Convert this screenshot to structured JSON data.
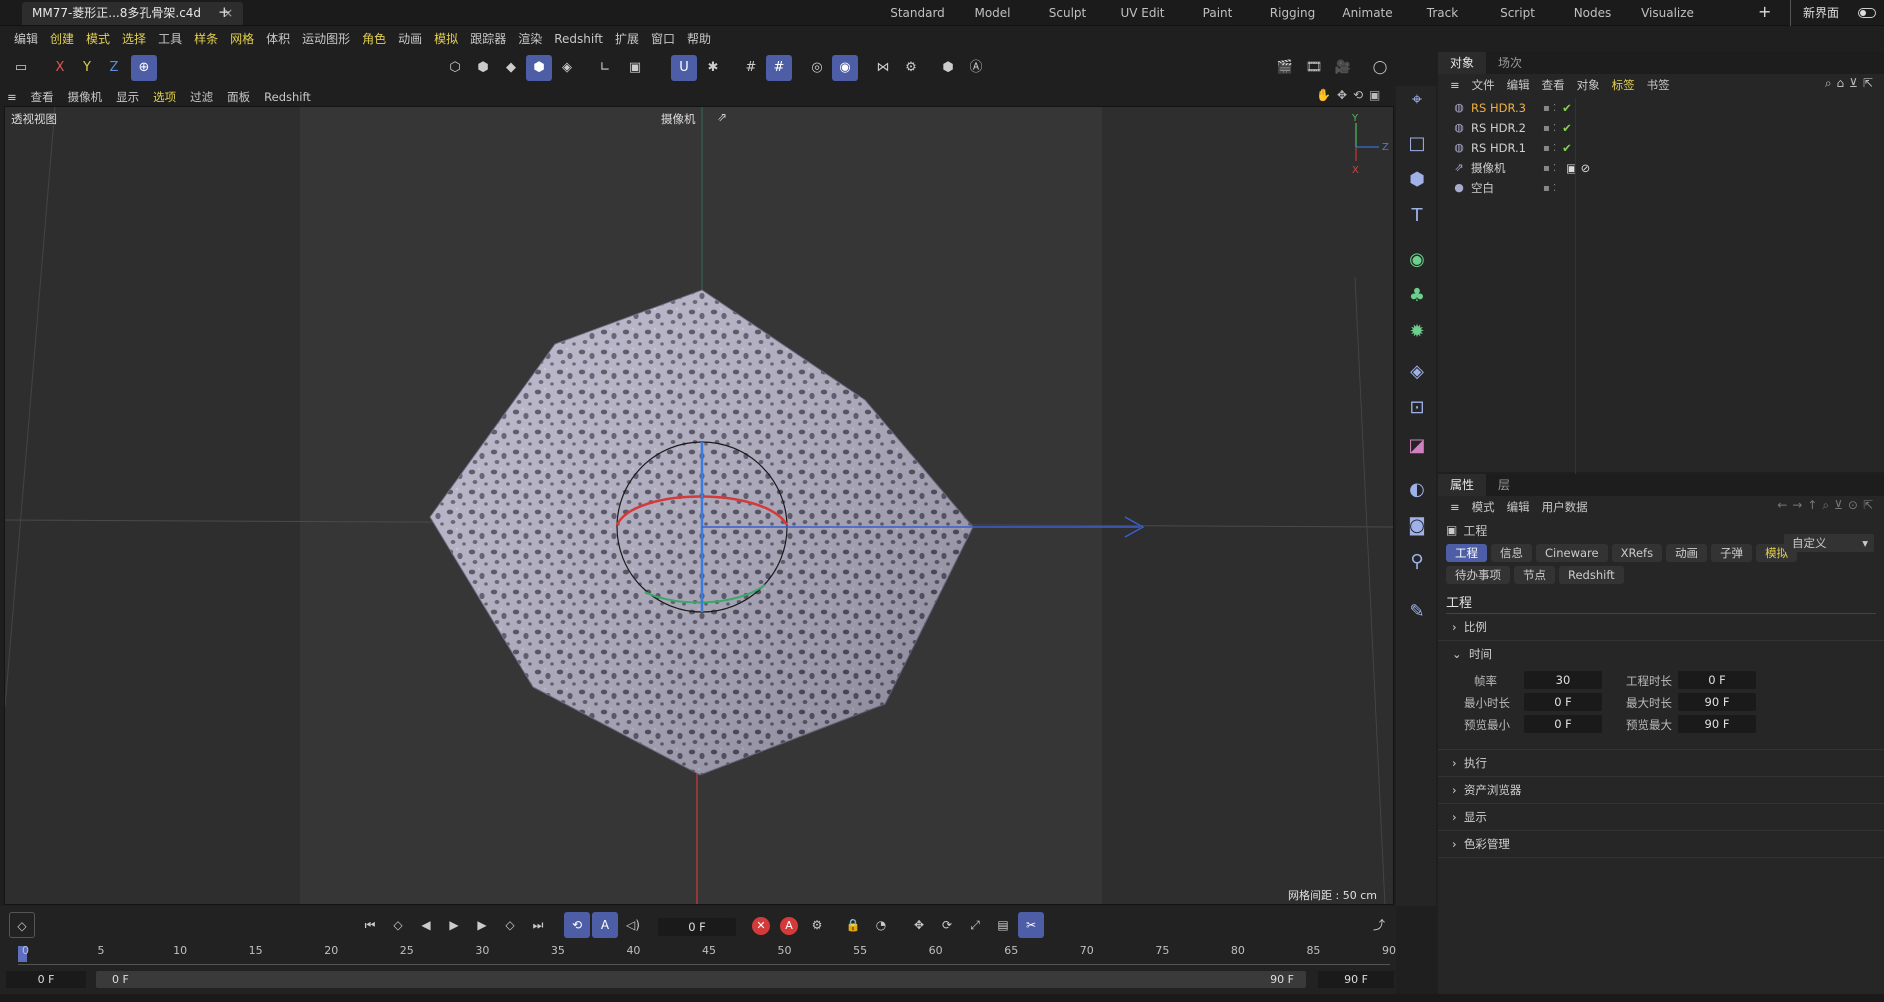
{
  "window": {
    "file_tab": "MM77-菱形正...8多孔骨架.c4d",
    "close": "×",
    "add": "+"
  },
  "layouts": [
    "Standard",
    "Model",
    "Sculpt",
    "UV Edit",
    "Paint",
    "Rigging",
    "Animate",
    "Track",
    "Script",
    "Nodes",
    "Visualize"
  ],
  "layout_add": "+",
  "new_ui": "新界面",
  "menu": [
    {
      "label": "编辑",
      "hl": false
    },
    {
      "label": "创建",
      "hl": true
    },
    {
      "label": "模式",
      "hl": true
    },
    {
      "label": "选择",
      "hl": true
    },
    {
      "label": "工具",
      "hl": false
    },
    {
      "label": "样条",
      "hl": true
    },
    {
      "label": "网格",
      "hl": true
    },
    {
      "label": "体积",
      "hl": false
    },
    {
      "label": "运动图形",
      "hl": false
    },
    {
      "label": "角色",
      "hl": true
    },
    {
      "label": "动画",
      "hl": false
    },
    {
      "label": "模拟",
      "hl": true
    },
    {
      "label": "跟踪器",
      "hl": false
    },
    {
      "label": "渲染",
      "hl": false
    },
    {
      "label": "Redshift",
      "hl": false
    },
    {
      "label": "扩展",
      "hl": false
    },
    {
      "label": "窗口",
      "hl": false
    },
    {
      "label": "帮助",
      "hl": false
    }
  ],
  "toolbar": {
    "x": "X",
    "y": "Y",
    "z": "Z"
  },
  "viewport_menu": [
    {
      "label": "查看",
      "hl": false
    },
    {
      "label": "摄像机",
      "hl": false
    },
    {
      "label": "显示",
      "hl": false
    },
    {
      "label": "选项",
      "hl": true
    },
    {
      "label": "过滤",
      "hl": false
    },
    {
      "label": "面板",
      "hl": false
    },
    {
      "label": "Redshift",
      "hl": false
    }
  ],
  "viewport": {
    "label": "透视视图",
    "camera": "摄像机",
    "grid_spacing": "网格间距 : 50 cm",
    "axis_y": "Y",
    "axis_z": "Z",
    "axis_x": "X"
  },
  "object_panel": {
    "tabs": [
      "对象",
      "场次"
    ],
    "menu": [
      {
        "label": "文件",
        "hl": false
      },
      {
        "label": "编辑",
        "hl": false
      },
      {
        "label": "查看",
        "hl": false
      },
      {
        "label": "对象",
        "hl": false
      },
      {
        "label": "标签",
        "hl": true
      },
      {
        "label": "书签",
        "hl": false
      }
    ],
    "objects": [
      {
        "name": "RS HDR.3",
        "selected": true,
        "check": "✔"
      },
      {
        "name": "RS HDR.2",
        "selected": false,
        "check": "✔"
      },
      {
        "name": "RS HDR.1",
        "selected": false,
        "check": "✔"
      },
      {
        "name": "摄像机",
        "selected": false,
        "check": ""
      },
      {
        "name": "空白",
        "selected": false,
        "check": ""
      }
    ]
  },
  "attr_panel": {
    "tabs": [
      "属性",
      "层"
    ],
    "menu": [
      "模式",
      "编辑",
      "用户数据"
    ],
    "title": "工程",
    "preset": "自定义",
    "buttons_row1": [
      "工程",
      "信息",
      "Cineware",
      "XRefs",
      "动画",
      "子弹",
      "模拟"
    ],
    "buttons_row2": [
      "待办事项",
      "节点",
      "Redshift"
    ],
    "section_title": "工程",
    "sections": {
      "ratio": "比例",
      "time": "时间",
      "exec": "执行",
      "asset": "资产浏览器",
      "display": "显示",
      "color": "色彩管理"
    },
    "fields": {
      "fps_label": "帧率",
      "fps": "30",
      "proj_len_label": "工程时长",
      "proj_len": "0 F",
      "min_label": "最小时长",
      "min": "0 F",
      "max_label": "最大时长",
      "max": "90 F",
      "pmin_label": "预览最小",
      "pmin": "0 F",
      "pmax_label": "预览最大",
      "pmax": "90 F"
    }
  },
  "timeline": {
    "current_frame": "0 F",
    "ticks": [
      "0",
      "5",
      "10",
      "15",
      "20",
      "25",
      "30",
      "35",
      "40",
      "45",
      "50",
      "55",
      "60",
      "65",
      "70",
      "75",
      "80",
      "85",
      "90"
    ],
    "start": "0 F",
    "range_start": "0 F",
    "range_end": "90 F",
    "end": "90 F"
  }
}
